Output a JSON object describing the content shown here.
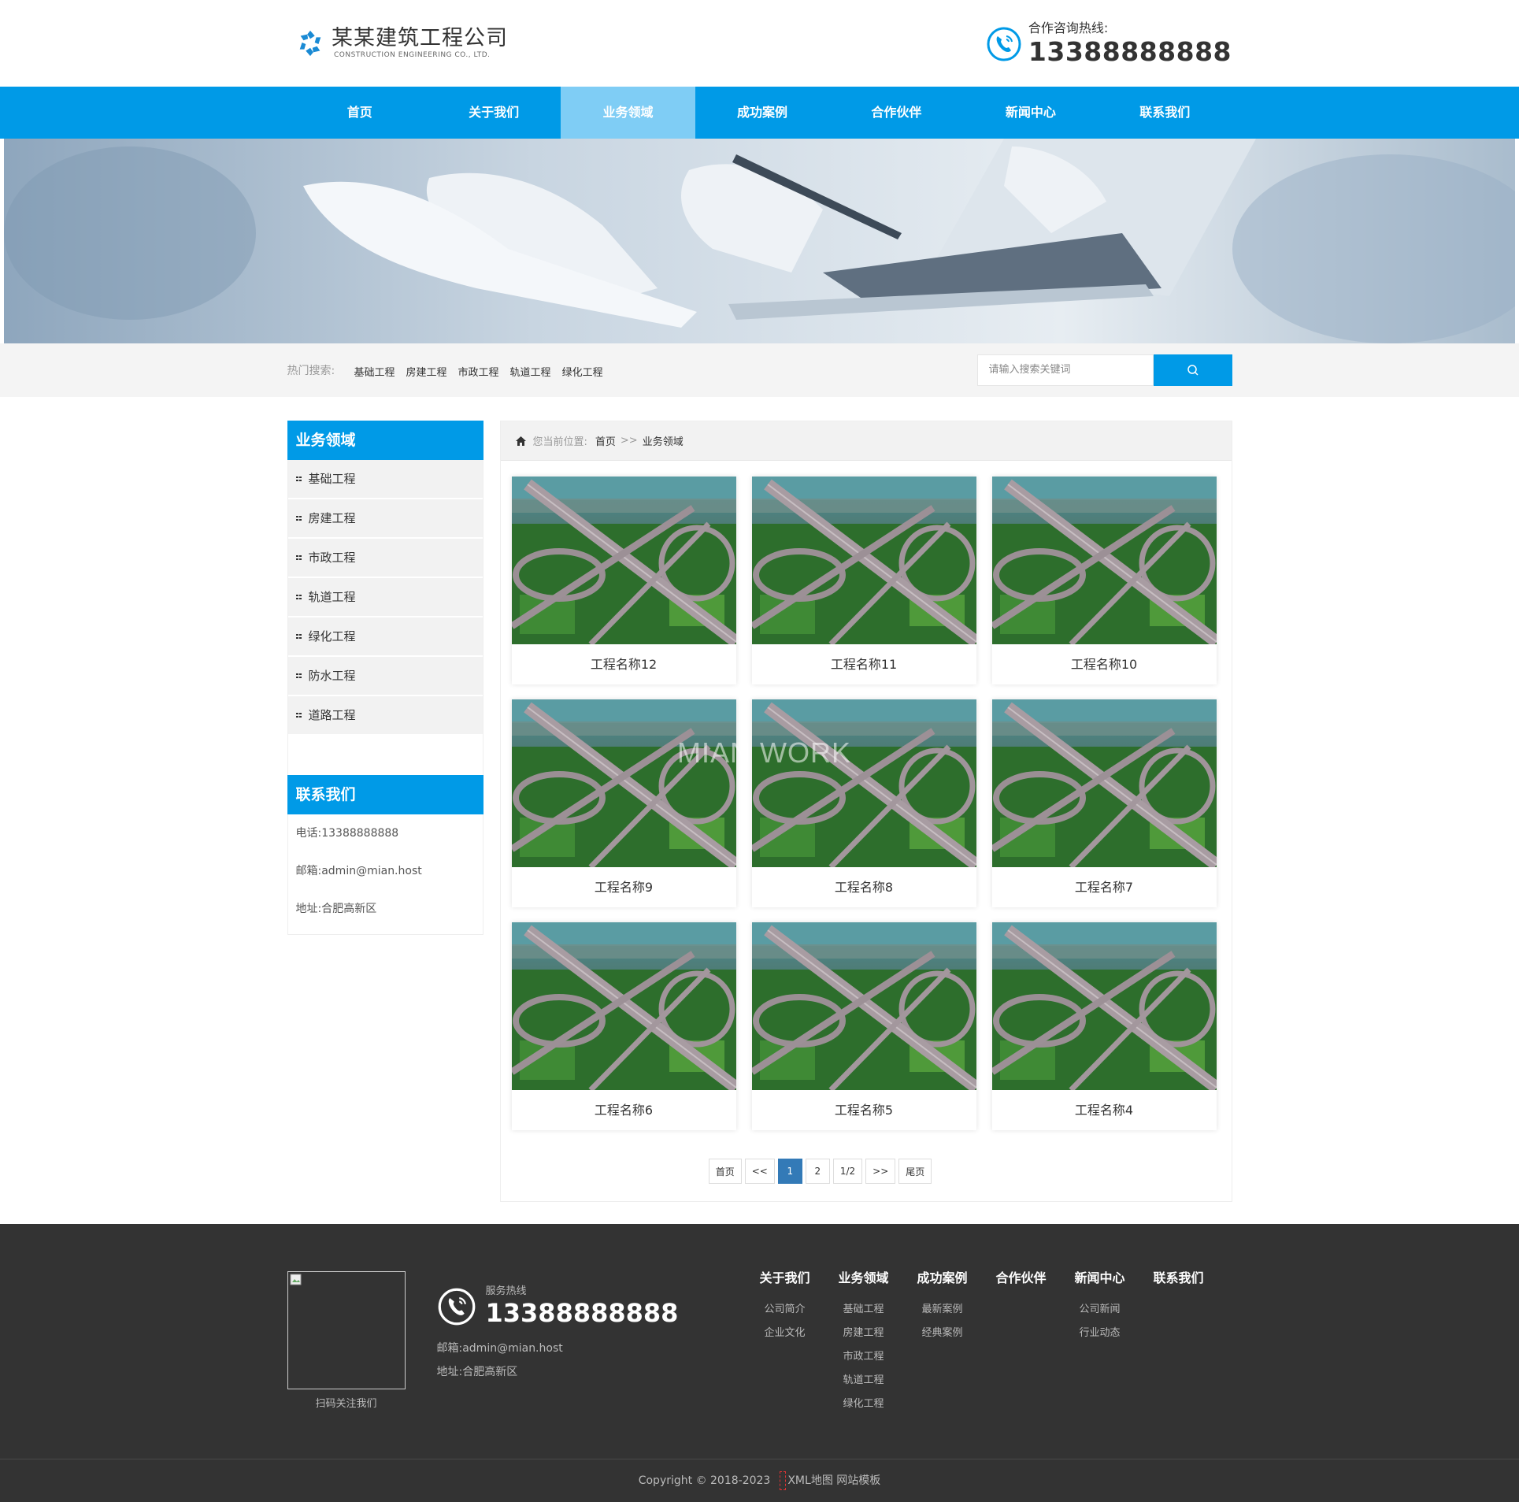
{
  "header": {
    "logo_cn": "某某建筑工程公司",
    "logo_en": "CONSTRUCTION ENGINEERING CO., LTD.",
    "hotline_label": "合作咨询热线:",
    "hotline_number": "13388888888"
  },
  "nav": {
    "items": [
      {
        "label": "首页"
      },
      {
        "label": "关于我们"
      },
      {
        "label": "业务领域"
      },
      {
        "label": "成功案例"
      },
      {
        "label": "合作伙伴"
      },
      {
        "label": "新闻中心"
      },
      {
        "label": "联系我们"
      }
    ],
    "active_index": 2
  },
  "hot_search": {
    "label": "热门搜索:",
    "links": [
      "基础工程",
      "房建工程",
      "市政工程",
      "轨道工程",
      "绿化工程"
    ],
    "placeholder": "请输入搜索关键词"
  },
  "sidebar": {
    "title": "业务领域",
    "items": [
      "基础工程",
      "房建工程",
      "市政工程",
      "轨道工程",
      "绿化工程",
      "防水工程",
      "道路工程"
    ],
    "contact_title": "联系我们",
    "phone": "电话:13388888888",
    "email": "邮箱:admin@mian.host",
    "address": "地址:合肥高新区"
  },
  "breadcrumb": {
    "prefix": "您当前位置:",
    "home": "首页",
    "separator": ">>",
    "current": "业务领域"
  },
  "projects": [
    {
      "title": "工程名称12"
    },
    {
      "title": "工程名称11"
    },
    {
      "title": "工程名称10"
    },
    {
      "title": "工程名称9"
    },
    {
      "title": "工程名称8"
    },
    {
      "title": "工程名称7"
    },
    {
      "title": "工程名称6"
    },
    {
      "title": "工程名称5"
    },
    {
      "title": "工程名称4"
    }
  ],
  "watermark": "MIAN WORK",
  "pager": {
    "first": "首页",
    "prev": "<<",
    "pages": [
      "1",
      "2"
    ],
    "current": "1",
    "info": "1/2",
    "next": ">>",
    "last": "尾页"
  },
  "footer": {
    "qr_label": "扫码关注我们",
    "hot_label": "服务热线",
    "hot_number": "13388888888",
    "email": "邮箱:admin@mian.host",
    "address": "地址:合肥高新区",
    "columns": [
      {
        "title": "关于我们",
        "items": [
          "公司简介",
          "企业文化"
        ]
      },
      {
        "title": "业务领域",
        "items": [
          "基础工程",
          "房建工程",
          "市政工程",
          "轨道工程",
          "绿化工程"
        ]
      },
      {
        "title": "成功案例",
        "items": [
          "最新案例",
          "经典案例"
        ]
      },
      {
        "title": "合作伙伴",
        "items": []
      },
      {
        "title": "新闻中心",
        "items": [
          "公司新闻",
          "行业动态"
        ]
      },
      {
        "title": "联系我们",
        "items": []
      }
    ],
    "copyright": "Copyright © 2018-2023",
    "links": [
      "XML地图",
      "网站模板"
    ]
  },
  "colors": {
    "primary": "#009ae7",
    "nav_active": "#7fcdf5",
    "footer_bg": "#333333",
    "pager_current": "#337ab7"
  },
  "icons": {
    "logo": "logo-pinwheel-icon",
    "hotline": "phone-icon",
    "search": "search-icon",
    "breadcrumb": "home-icon",
    "sidebar_bullet": "dots-icon"
  }
}
